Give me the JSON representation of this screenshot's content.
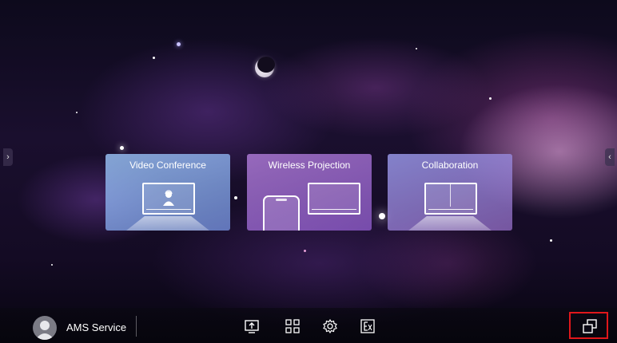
{
  "cards": [
    {
      "title": "Video Conference"
    },
    {
      "title": "Wireless Projection"
    },
    {
      "title": "Collaboration"
    }
  ],
  "taskbar": {
    "user_name": "AMS Service",
    "icons": [
      "screen-share-icon",
      "apps-grid-icon",
      "settings-gear-icon",
      "whiteboard-icon"
    ],
    "right_icon": "window-switch-icon"
  },
  "sidebar_toggles": {
    "left": "›",
    "right": "‹"
  },
  "colors": {
    "highlight": "#e0171b",
    "card_video": "#96bef0",
    "card_wireless": "#aa78d2",
    "card_collab": "#9696e6"
  }
}
